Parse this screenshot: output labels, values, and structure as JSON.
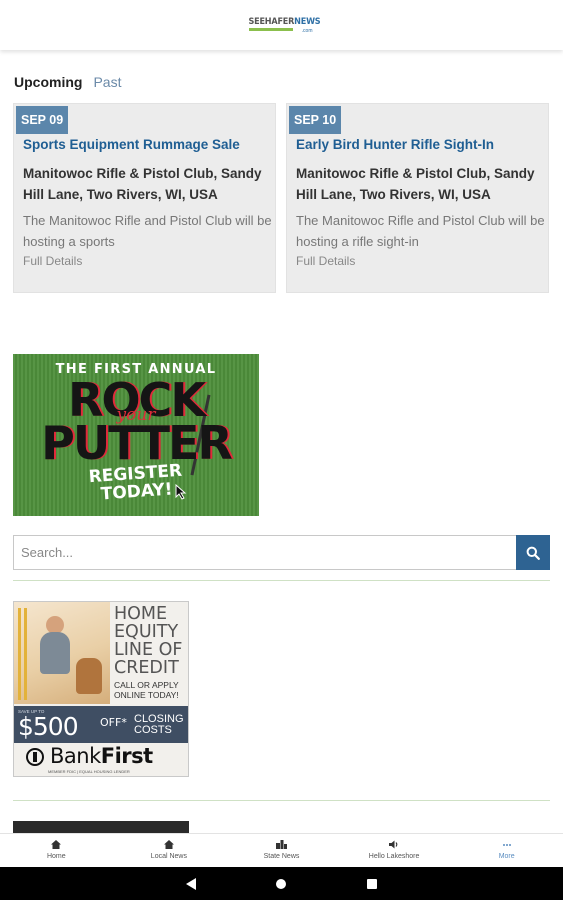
{
  "header": {
    "logo_main": "SEEHAFER",
    "logo_accent": "NEWS",
    "logo_domain": ".com"
  },
  "tabs": {
    "upcoming": "Upcoming",
    "past": "Past"
  },
  "events": [
    {
      "date": "SEP 09",
      "title": "Sports Equipment Rummage Sale",
      "location": "Manitowoc Rifle & Pistol Club, Sandy Hill Lane, Two Rivers, WI, USA",
      "description": "The Manitowoc Rifle and Pistol Club will be hosting a sports",
      "link": "Full Details"
    },
    {
      "date": "SEP 10",
      "title": "Early Bird Hunter Rifle Sight-In",
      "location": "Manitowoc Rifle & Pistol Club, Sandy Hill Lane, Two Rivers, WI, USA",
      "description": "The Manitowoc Rifle and Pistol Club will be hosting a rifle sight-in",
      "link": "Full Details"
    }
  ],
  "ad_putter": {
    "line1": "THE FIRST ANNUAL",
    "rock": "ROCK",
    "your": "your",
    "putter": "PUTTER",
    "cta_line1": "REGISTER",
    "cta_line2": "TODAY!",
    "bg_color": "#4e8f3b",
    "accent_color": "#e02a3a"
  },
  "search": {
    "placeholder": "Search...",
    "value": "",
    "icon": "search-icon"
  },
  "ad_bank": {
    "heading_lines": [
      "HOME",
      "EQUITY",
      "LINE OF",
      "CREDIT"
    ],
    "cta_lines": [
      "CALL OR APPLY",
      "ONLINE TODAY!"
    ],
    "save_note": "SAVE UP TO",
    "amount": "$500",
    "off": "OFF*",
    "closing_lines": [
      "CLOSING",
      "COSTS"
    ],
    "brand_plain": "Bank",
    "brand_bold": "First",
    "fine_print": "MEMBER FDIC | EQUAL HOUSING LENDER"
  },
  "bottom_nav": [
    {
      "label": "Home",
      "icon": "home-icon",
      "active": false
    },
    {
      "label": "Local News",
      "icon": "home-icon",
      "active": false
    },
    {
      "label": "State News",
      "icon": "buildings-icon",
      "active": false
    },
    {
      "label": "Hello Lakeshore",
      "icon": "speaker-icon",
      "active": false
    },
    {
      "label": "More",
      "icon": "more-dots-icon",
      "active": true
    }
  ],
  "colors": {
    "brand_blue": "#2e6392",
    "badge_blue": "#5b86ab",
    "title_blue": "#1f5e93",
    "divider_green": "#cfe1c5",
    "active_nav": "#5a8dc0"
  }
}
